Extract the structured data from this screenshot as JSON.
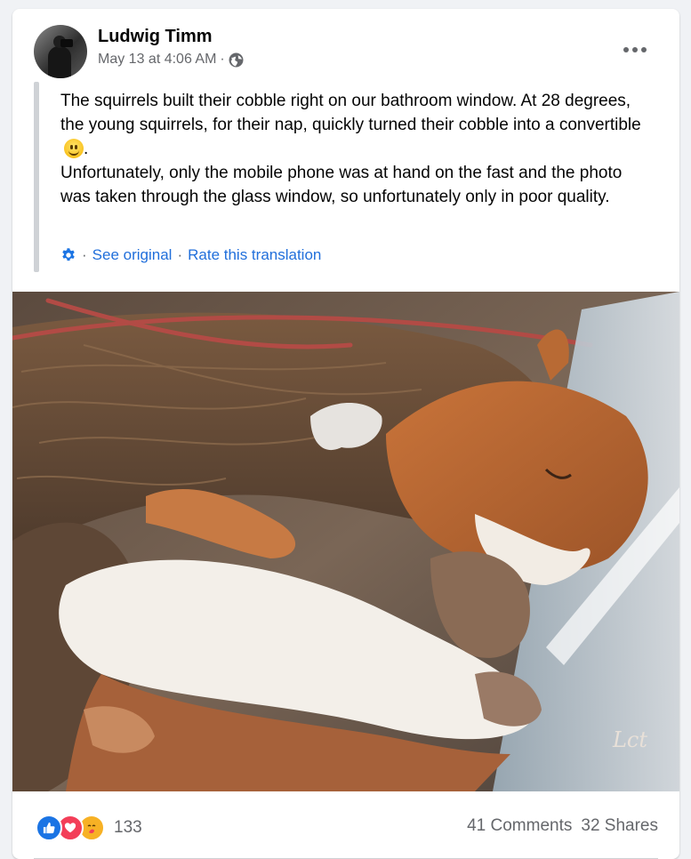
{
  "post": {
    "author": "Ludwig Timm",
    "timestamp": "May 13 at 4:06 AM",
    "timestamp_separator": "·",
    "privacy_icon": "globe-icon",
    "more_icon": "more-horizontal-icon",
    "text_line1": "The squirrels built their cobble right on our bathroom window. At 28 degrees, the young squirrels, for their nap, quickly turned their cobble into a convertible",
    "text_line1_end": ".",
    "text_line2": "Unfortunately, only the mobile phone was at hand on the fast and the photo was taken through the glass window, so unfortunately only in poor quality.",
    "emoji": "slightly-smiling-face-icon"
  },
  "translation": {
    "icon": "gear-icon",
    "separator": "·",
    "see_original": "See original",
    "rate": "Rate this translation"
  },
  "photo": {
    "subject": "two young red squirrels sleeping in a nest on a window sill",
    "watermark": "Lct"
  },
  "footer": {
    "reaction_icons": [
      "like-icon",
      "love-icon",
      "care-icon"
    ],
    "reaction_count": "133",
    "comments": "41 Comments",
    "shares": "32 Shares"
  },
  "colors": {
    "link": "#216fdb",
    "secondary_text": "#65676b",
    "like": "#1b74e4",
    "love": "#f33e58",
    "care": "#f7b125"
  }
}
